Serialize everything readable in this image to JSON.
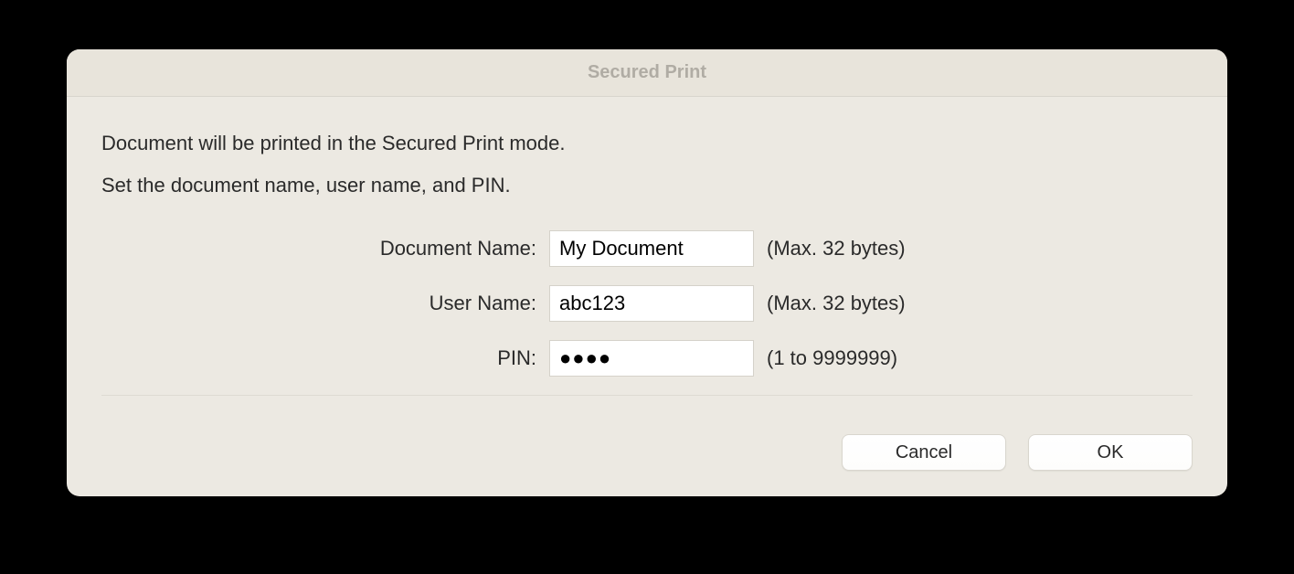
{
  "dialog": {
    "title": "Secured Print",
    "intro1": "Document will be printed in the Secured Print mode.",
    "intro2": "Set the document name, user name, and PIN.",
    "fields": {
      "documentName": {
        "label": "Document Name:",
        "value": "My Document",
        "hint": "(Max. 32 bytes)"
      },
      "userName": {
        "label": "User Name:",
        "value": "abc123",
        "hint": "(Max. 32 bytes)"
      },
      "pin": {
        "label": "PIN:",
        "masked": "●●●●",
        "hint": "(1 to 9999999)"
      }
    },
    "buttons": {
      "cancel": "Cancel",
      "ok": "OK"
    }
  }
}
